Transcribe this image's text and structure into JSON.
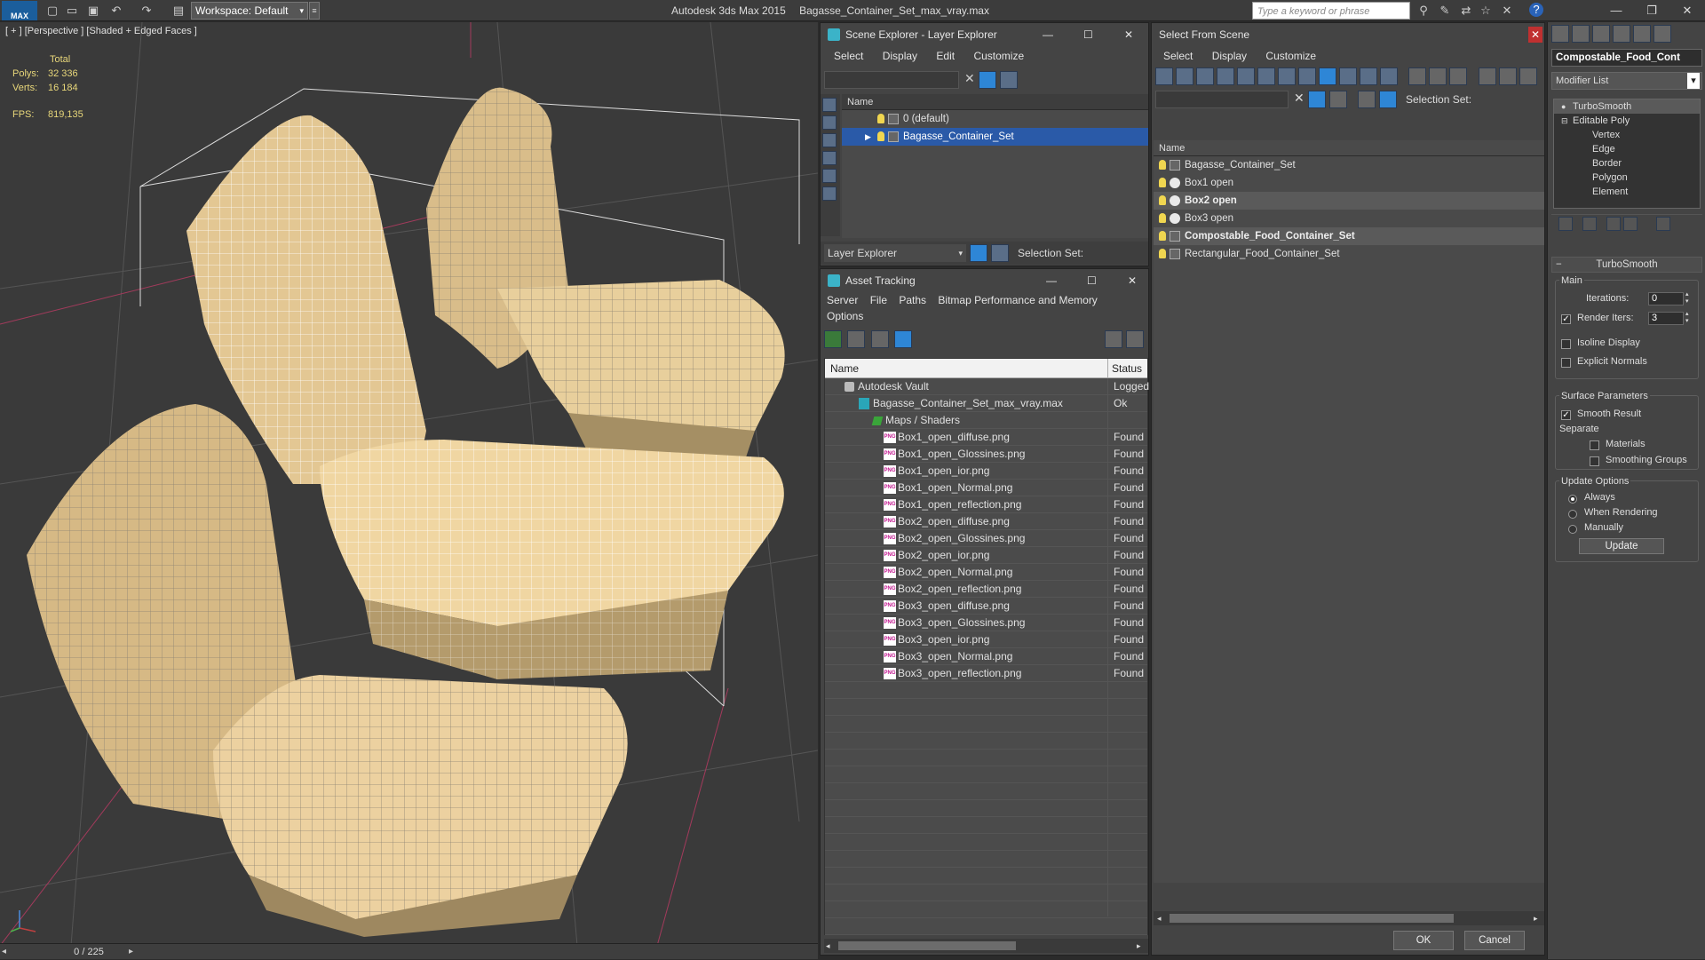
{
  "titlebar": {
    "app_title": "Autodesk 3ds Max  2015",
    "file_title": "Bagasse_Container_Set_max_vray.max",
    "logo": "MAX",
    "workspace": "Workspace: Default",
    "search_placeholder": "Type a keyword or phrase"
  },
  "viewport": {
    "label": "[ + ] [Perspective ] [Shaded + Edged Faces ]",
    "stats": {
      "total_label": "Total",
      "polys_label": "Polys:",
      "polys_value": "32 336",
      "verts_label": "Verts:",
      "verts_value": "16 184",
      "fps_label": "FPS:",
      "fps_value": "819,135"
    },
    "timeline_frame": "0 / 225"
  },
  "scene_explorer": {
    "title": "Scene Explorer - Layer Explorer",
    "menu": [
      "Select",
      "Display",
      "Edit",
      "Customize"
    ],
    "name_header": "Name",
    "layers": [
      {
        "name": "0 (default)",
        "selected": false
      },
      {
        "name": "Bagasse_Container_Set",
        "selected": true
      }
    ],
    "footer_dropdown": "Layer Explorer",
    "selection_set_label": "Selection Set:"
  },
  "asset_tracking": {
    "title": "Asset Tracking",
    "menu": [
      "Server",
      "File",
      "Paths",
      "Bitmap Performance and Memory",
      "Options"
    ],
    "col_name": "Name",
    "col_status": "Status",
    "rows": [
      {
        "name": "Autodesk Vault",
        "status": "Logged",
        "indent": 1,
        "kind": "vault"
      },
      {
        "name": "Bagasse_Container_Set_max_vray.max",
        "status": "Ok",
        "indent": 2,
        "kind": "max"
      },
      {
        "name": "Maps / Shaders",
        "status": "",
        "indent": 3,
        "kind": "folder"
      },
      {
        "name": "Box1_open_diffuse.png",
        "status": "Found",
        "indent": 4,
        "kind": "png"
      },
      {
        "name": "Box1_open_Glossines.png",
        "status": "Found",
        "indent": 4,
        "kind": "png"
      },
      {
        "name": "Box1_open_ior.png",
        "status": "Found",
        "indent": 4,
        "kind": "png"
      },
      {
        "name": "Box1_open_Normal.png",
        "status": "Found",
        "indent": 4,
        "kind": "png"
      },
      {
        "name": "Box1_open_reflection.png",
        "status": "Found",
        "indent": 4,
        "kind": "png"
      },
      {
        "name": "Box2_open_diffuse.png",
        "status": "Found",
        "indent": 4,
        "kind": "png"
      },
      {
        "name": "Box2_open_Glossines.png",
        "status": "Found",
        "indent": 4,
        "kind": "png"
      },
      {
        "name": "Box2_open_ior.png",
        "status": "Found",
        "indent": 4,
        "kind": "png"
      },
      {
        "name": "Box2_open_Normal.png",
        "status": "Found",
        "indent": 4,
        "kind": "png"
      },
      {
        "name": "Box2_open_reflection.png",
        "status": "Found",
        "indent": 4,
        "kind": "png"
      },
      {
        "name": "Box3_open_diffuse.png",
        "status": "Found",
        "indent": 4,
        "kind": "png"
      },
      {
        "name": "Box3_open_Glossines.png",
        "status": "Found",
        "indent": 4,
        "kind": "png"
      },
      {
        "name": "Box3_open_ior.png",
        "status": "Found",
        "indent": 4,
        "kind": "png"
      },
      {
        "name": "Box3_open_Normal.png",
        "status": "Found",
        "indent": 4,
        "kind": "png"
      },
      {
        "name": "Box3_open_reflection.png",
        "status": "Found",
        "indent": 4,
        "kind": "png"
      }
    ]
  },
  "select_from_scene": {
    "title": "Select From Scene",
    "menu": [
      "Select",
      "Display",
      "Customize"
    ],
    "selection_set_label": "Selection Set:",
    "name_header": "Name",
    "items": [
      {
        "name": "Bagasse_Container_Set",
        "kind": "group",
        "highlight": false
      },
      {
        "name": "Box1 open",
        "kind": "mesh",
        "highlight": false
      },
      {
        "name": "Box2 open",
        "kind": "mesh",
        "highlight": true
      },
      {
        "name": "Box3 open",
        "kind": "mesh",
        "highlight": false
      },
      {
        "name": "Compostable_Food_Container_Set",
        "kind": "group",
        "highlight": true
      },
      {
        "name": "Rectangular_Food_Container_Set",
        "kind": "group",
        "highlight": false
      }
    ],
    "ok": "OK",
    "cancel": "Cancel"
  },
  "command_panel": {
    "object_name": "Compostable_Food_Cont",
    "modifier_list": "Modifier List",
    "stack": [
      {
        "name": "TurboSmooth",
        "level": 0
      },
      {
        "name": "Editable Poly",
        "level": 0
      },
      {
        "name": "Vertex",
        "level": 1
      },
      {
        "name": "Edge",
        "level": 1
      },
      {
        "name": "Border",
        "level": 1
      },
      {
        "name": "Polygon",
        "level": 1
      },
      {
        "name": "Element",
        "level": 1
      }
    ],
    "rollout_title": "TurboSmooth",
    "main_label": "Main",
    "iterations_label": "Iterations:",
    "iterations_value": "0",
    "render_iters_label": "Render Iters:",
    "render_iters_value": "3",
    "isoline_label": "Isoline Display",
    "explicit_normals_label": "Explicit Normals",
    "surface_params_label": "Surface Parameters",
    "smooth_result_label": "Smooth Result",
    "separate_label": "Separate",
    "materials_label": "Materials",
    "smoothing_groups_label": "Smoothing Groups",
    "update_options_label": "Update Options",
    "always_label": "Always",
    "when_rendering_label": "When Rendering",
    "manually_label": "Manually",
    "update_button": "Update"
  }
}
